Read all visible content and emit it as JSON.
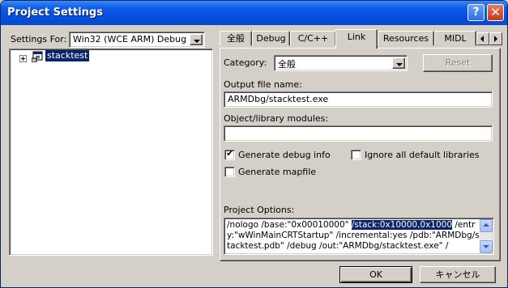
{
  "window": {
    "title": "Project Settings",
    "help_glyph": "?",
    "close_glyph": "✕"
  },
  "left_pane": {
    "settings_for_label": "Settings For:",
    "settings_for_value": "Win32 (WCE ARM) Debug",
    "tree": {
      "expander_glyph": "+",
      "items": [
        {
          "label": "stacktest",
          "icon": "project-icon",
          "selected": true
        }
      ]
    }
  },
  "tabs": [
    {
      "label": "全般",
      "active": false
    },
    {
      "label": "Debug",
      "active": false
    },
    {
      "label": "C/C++",
      "active": false
    },
    {
      "label": "Link",
      "active": true
    },
    {
      "label": "Resources",
      "active": false
    },
    {
      "label": "MIDL",
      "active": false
    }
  ],
  "link_page": {
    "category_label": "Category:",
    "category_value": "全般",
    "reset_label": "Reset",
    "output_file_label": "Output file name:",
    "output_file_value": "ARMDbg/stacktest.exe",
    "modules_label": "Object/library modules:",
    "modules_value": "",
    "generate_debug_info_label": "Generate debug info",
    "generate_debug_info_checked": true,
    "ignore_default_libs_label": "Ignore all default libraries",
    "ignore_default_libs_checked": false,
    "generate_mapfile_label": "Generate mapfile",
    "generate_mapfile_checked": false,
    "project_options_label": "Project Options:",
    "project_options_before": "/nologo /base:\"0x00010000\" ",
    "project_options_selected": "/stack:0x10000,0x1000",
    "project_options_after": " /entry:\"wWinMainCRTStartup\" /incremental:yes /pdb:\"ARMDbg/stacktest.pdb\" /debug /out:\"ARMDbg/stacktest.exe\" /"
  },
  "footer": {
    "ok_label": "OK",
    "cancel_label": "キャンセル"
  },
  "colors": {
    "titlebar": "#0054e3",
    "selection": "#0a246a",
    "face": "#d4d0c8"
  }
}
